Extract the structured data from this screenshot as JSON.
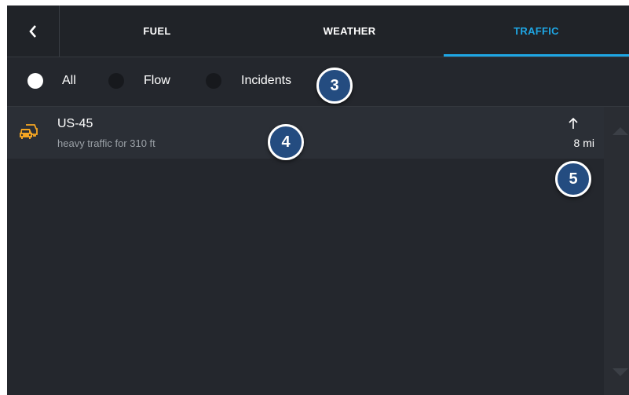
{
  "tabs": [
    {
      "label": "FUEL",
      "active": false
    },
    {
      "label": "WEATHER",
      "active": false
    },
    {
      "label": "TRAFFIC",
      "active": true
    }
  ],
  "filters": {
    "options": [
      {
        "label": "All",
        "selected": true
      },
      {
        "label": "Flow",
        "selected": false
      },
      {
        "label": "Incidents",
        "selected": false
      }
    ]
  },
  "traffic_list": [
    {
      "icon": "traffic-cars-icon",
      "road": "US-45",
      "description": "heavy traffic for 310 ft",
      "direction": "north-arrow-icon",
      "distance": "8 mi"
    }
  ],
  "callouts": [
    "3",
    "4",
    "5"
  ],
  "colors": {
    "accent": "#1ea6e4",
    "traffic_icon": "#f5a623",
    "callout_fill": "#244c80"
  }
}
